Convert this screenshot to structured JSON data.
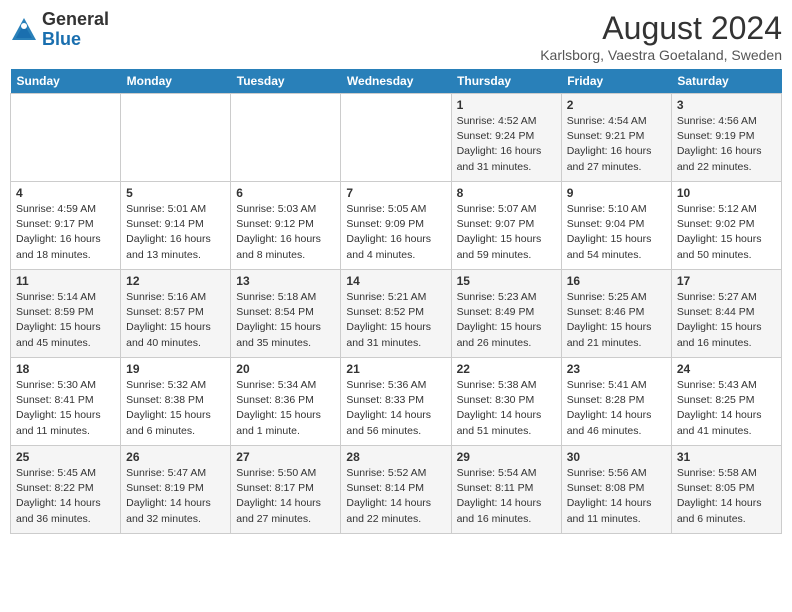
{
  "header": {
    "logo_general": "General",
    "logo_blue": "Blue",
    "month_year": "August 2024",
    "location": "Karlsborg, Vaestra Goetaland, Sweden"
  },
  "days_of_week": [
    "Sunday",
    "Monday",
    "Tuesday",
    "Wednesday",
    "Thursday",
    "Friday",
    "Saturday"
  ],
  "weeks": [
    [
      {
        "day": "",
        "info": ""
      },
      {
        "day": "",
        "info": ""
      },
      {
        "day": "",
        "info": ""
      },
      {
        "day": "",
        "info": ""
      },
      {
        "day": "1",
        "info": "Sunrise: 4:52 AM\nSunset: 9:24 PM\nDaylight: 16 hours\nand 31 minutes."
      },
      {
        "day": "2",
        "info": "Sunrise: 4:54 AM\nSunset: 9:21 PM\nDaylight: 16 hours\nand 27 minutes."
      },
      {
        "day": "3",
        "info": "Sunrise: 4:56 AM\nSunset: 9:19 PM\nDaylight: 16 hours\nand 22 minutes."
      }
    ],
    [
      {
        "day": "4",
        "info": "Sunrise: 4:59 AM\nSunset: 9:17 PM\nDaylight: 16 hours\nand 18 minutes."
      },
      {
        "day": "5",
        "info": "Sunrise: 5:01 AM\nSunset: 9:14 PM\nDaylight: 16 hours\nand 13 minutes."
      },
      {
        "day": "6",
        "info": "Sunrise: 5:03 AM\nSunset: 9:12 PM\nDaylight: 16 hours\nand 8 minutes."
      },
      {
        "day": "7",
        "info": "Sunrise: 5:05 AM\nSunset: 9:09 PM\nDaylight: 16 hours\nand 4 minutes."
      },
      {
        "day": "8",
        "info": "Sunrise: 5:07 AM\nSunset: 9:07 PM\nDaylight: 15 hours\nand 59 minutes."
      },
      {
        "day": "9",
        "info": "Sunrise: 5:10 AM\nSunset: 9:04 PM\nDaylight: 15 hours\nand 54 minutes."
      },
      {
        "day": "10",
        "info": "Sunrise: 5:12 AM\nSunset: 9:02 PM\nDaylight: 15 hours\nand 50 minutes."
      }
    ],
    [
      {
        "day": "11",
        "info": "Sunrise: 5:14 AM\nSunset: 8:59 PM\nDaylight: 15 hours\nand 45 minutes."
      },
      {
        "day": "12",
        "info": "Sunrise: 5:16 AM\nSunset: 8:57 PM\nDaylight: 15 hours\nand 40 minutes."
      },
      {
        "day": "13",
        "info": "Sunrise: 5:18 AM\nSunset: 8:54 PM\nDaylight: 15 hours\nand 35 minutes."
      },
      {
        "day": "14",
        "info": "Sunrise: 5:21 AM\nSunset: 8:52 PM\nDaylight: 15 hours\nand 31 minutes."
      },
      {
        "day": "15",
        "info": "Sunrise: 5:23 AM\nSunset: 8:49 PM\nDaylight: 15 hours\nand 26 minutes."
      },
      {
        "day": "16",
        "info": "Sunrise: 5:25 AM\nSunset: 8:46 PM\nDaylight: 15 hours\nand 21 minutes."
      },
      {
        "day": "17",
        "info": "Sunrise: 5:27 AM\nSunset: 8:44 PM\nDaylight: 15 hours\nand 16 minutes."
      }
    ],
    [
      {
        "day": "18",
        "info": "Sunrise: 5:30 AM\nSunset: 8:41 PM\nDaylight: 15 hours\nand 11 minutes."
      },
      {
        "day": "19",
        "info": "Sunrise: 5:32 AM\nSunset: 8:38 PM\nDaylight: 15 hours\nand 6 minutes."
      },
      {
        "day": "20",
        "info": "Sunrise: 5:34 AM\nSunset: 8:36 PM\nDaylight: 15 hours\nand 1 minute."
      },
      {
        "day": "21",
        "info": "Sunrise: 5:36 AM\nSunset: 8:33 PM\nDaylight: 14 hours\nand 56 minutes."
      },
      {
        "day": "22",
        "info": "Sunrise: 5:38 AM\nSunset: 8:30 PM\nDaylight: 14 hours\nand 51 minutes."
      },
      {
        "day": "23",
        "info": "Sunrise: 5:41 AM\nSunset: 8:28 PM\nDaylight: 14 hours\nand 46 minutes."
      },
      {
        "day": "24",
        "info": "Sunrise: 5:43 AM\nSunset: 8:25 PM\nDaylight: 14 hours\nand 41 minutes."
      }
    ],
    [
      {
        "day": "25",
        "info": "Sunrise: 5:45 AM\nSunset: 8:22 PM\nDaylight: 14 hours\nand 36 minutes."
      },
      {
        "day": "26",
        "info": "Sunrise: 5:47 AM\nSunset: 8:19 PM\nDaylight: 14 hours\nand 32 minutes."
      },
      {
        "day": "27",
        "info": "Sunrise: 5:50 AM\nSunset: 8:17 PM\nDaylight: 14 hours\nand 27 minutes."
      },
      {
        "day": "28",
        "info": "Sunrise: 5:52 AM\nSunset: 8:14 PM\nDaylight: 14 hours\nand 22 minutes."
      },
      {
        "day": "29",
        "info": "Sunrise: 5:54 AM\nSunset: 8:11 PM\nDaylight: 14 hours\nand 16 minutes."
      },
      {
        "day": "30",
        "info": "Sunrise: 5:56 AM\nSunset: 8:08 PM\nDaylight: 14 hours\nand 11 minutes."
      },
      {
        "day": "31",
        "info": "Sunrise: 5:58 AM\nSunset: 8:05 PM\nDaylight: 14 hours\nand 6 minutes."
      }
    ]
  ]
}
